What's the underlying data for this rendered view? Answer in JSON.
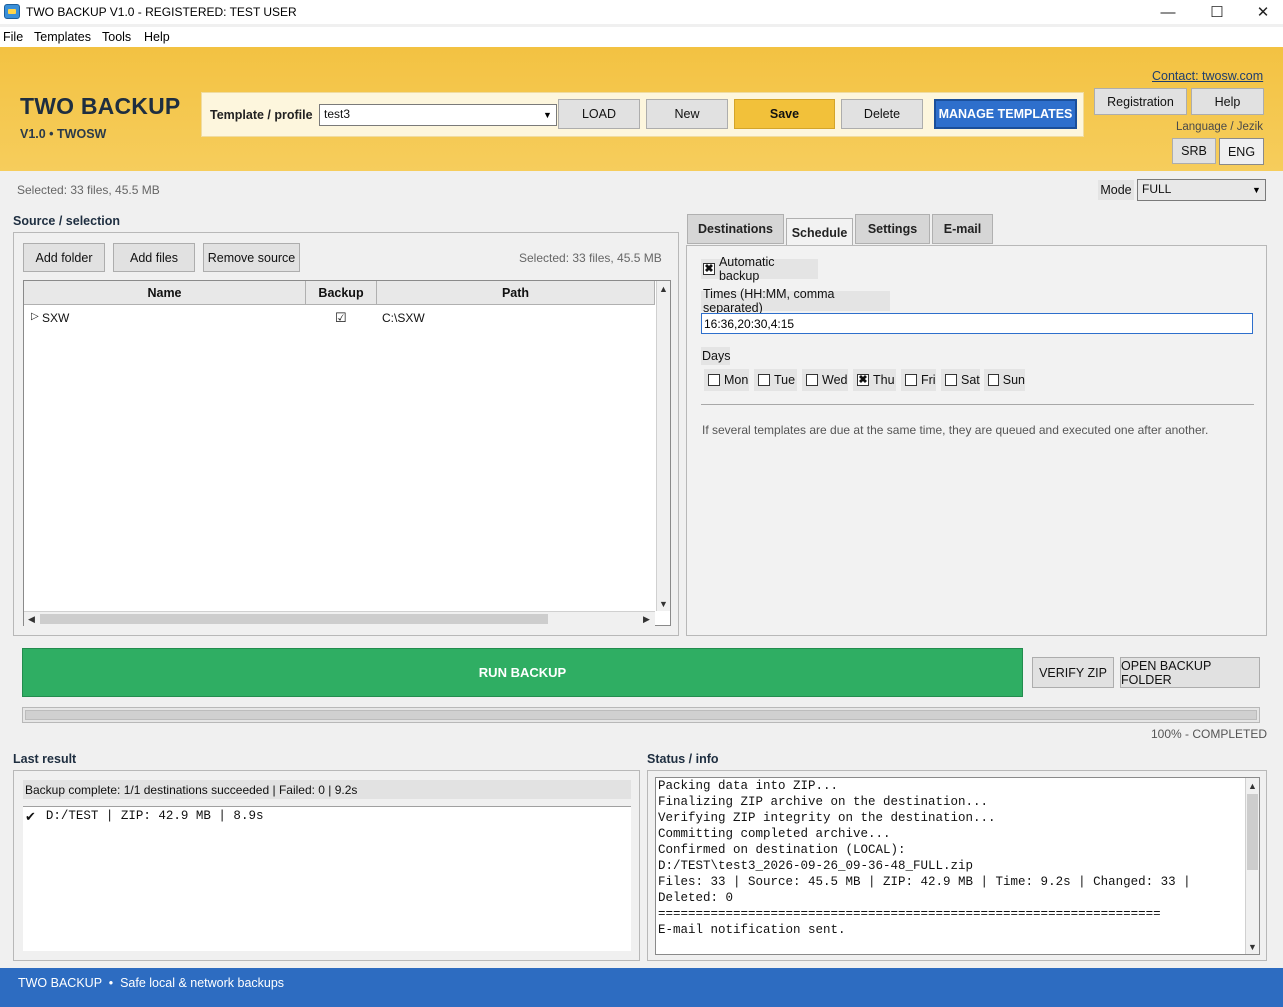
{
  "window": {
    "title": "TWO BACKUP V1.0 - REGISTERED: TEST USER",
    "minimize": "—",
    "maximize": "☐",
    "close": "✕"
  },
  "menu": [
    "File",
    "Templates",
    "Tools",
    "Help"
  ],
  "header": {
    "brand": "TWO BACKUP",
    "brand_sub": "V1.0 • TWOSW",
    "profile_label": "Template / profile",
    "profile_value": "test3",
    "load": "LOAD",
    "new": "New",
    "save": "Save",
    "delete": "Delete",
    "manage": "MANAGE TEMPLATES",
    "contact": "Contact: twosw.com",
    "registration": "Registration",
    "help": "Help",
    "language_label": "Language / Jezik",
    "lang_srb": "SRB",
    "lang_eng": "ENG"
  },
  "summary": {
    "selected": "Selected: 33 files, 45.5 MB",
    "mode_label": "Mode",
    "mode_value": "FULL"
  },
  "source": {
    "title": "Source / selection",
    "add_folder": "Add folder",
    "add_files": "Add files",
    "remove_source": "Remove source",
    "selected": "Selected: 33 files, 45.5 MB",
    "columns": {
      "name": "Name",
      "backup": "Backup",
      "path": "Path"
    },
    "rows": [
      {
        "name": "SXW",
        "backup": "☑",
        "path": "C:\\SXW"
      }
    ]
  },
  "tabs": {
    "destinations": "Destinations",
    "schedule": "Schedule",
    "settings": "Settings",
    "email": "E-mail"
  },
  "schedule": {
    "auto_backup": "Automatic backup",
    "auto_checked": "✖",
    "times_label": "Times (HH:MM, comma separated)",
    "times_value": "16:36,20:30,4:15",
    "days_label": "Days",
    "days": [
      {
        "label": "Mon",
        "mark": ""
      },
      {
        "label": "Tue",
        "mark": ""
      },
      {
        "label": "Wed",
        "mark": ""
      },
      {
        "label": "Thu",
        "mark": "✖"
      },
      {
        "label": "Fri",
        "mark": ""
      },
      {
        "label": "Sat",
        "mark": ""
      },
      {
        "label": "Sun",
        "mark": ""
      }
    ],
    "note": "If several templates are due at the same time, they are queued and executed one after another."
  },
  "actions": {
    "run": "RUN BACKUP",
    "verify": "VERIFY ZIP",
    "open_folder": "OPEN BACKUP FOLDER",
    "progress": 100,
    "progress_text": "100% - COMPLETED"
  },
  "last_result": {
    "title": "Last result",
    "summary": "Backup complete: 1/1 destinations succeeded | Failed: 0 | 9.2s",
    "check": "✔",
    "entry": "D:/TEST | ZIP: 42.9 MB | 8.9s"
  },
  "status": {
    "title": "Status / info",
    "lines": [
      "Packing data into ZIP...",
      "Finalizing ZIP archive on the destination...",
      "Verifying ZIP integrity on the destination...",
      "Committing completed archive...",
      "Confirmed on destination (LOCAL):",
      "D:/TEST\\test3_2026-09-26_09-36-48_FULL.zip",
      "Files: 33 | Source: 45.5 MB | ZIP: 42.9 MB | Time: 9.2s | Changed: 33 |",
      "Deleted: 0",
      "===================================================================",
      "E-mail notification sent."
    ]
  },
  "footer": {
    "text": "TWO BACKUP  •  Safe local & network backups"
  },
  "colors": {
    "header_bg": "#f3c242",
    "save_bg": "#f2c13a",
    "manage_bg": "#2e6fcc",
    "run_bg": "#2fae63",
    "footer_bg": "#2d6cc1"
  }
}
